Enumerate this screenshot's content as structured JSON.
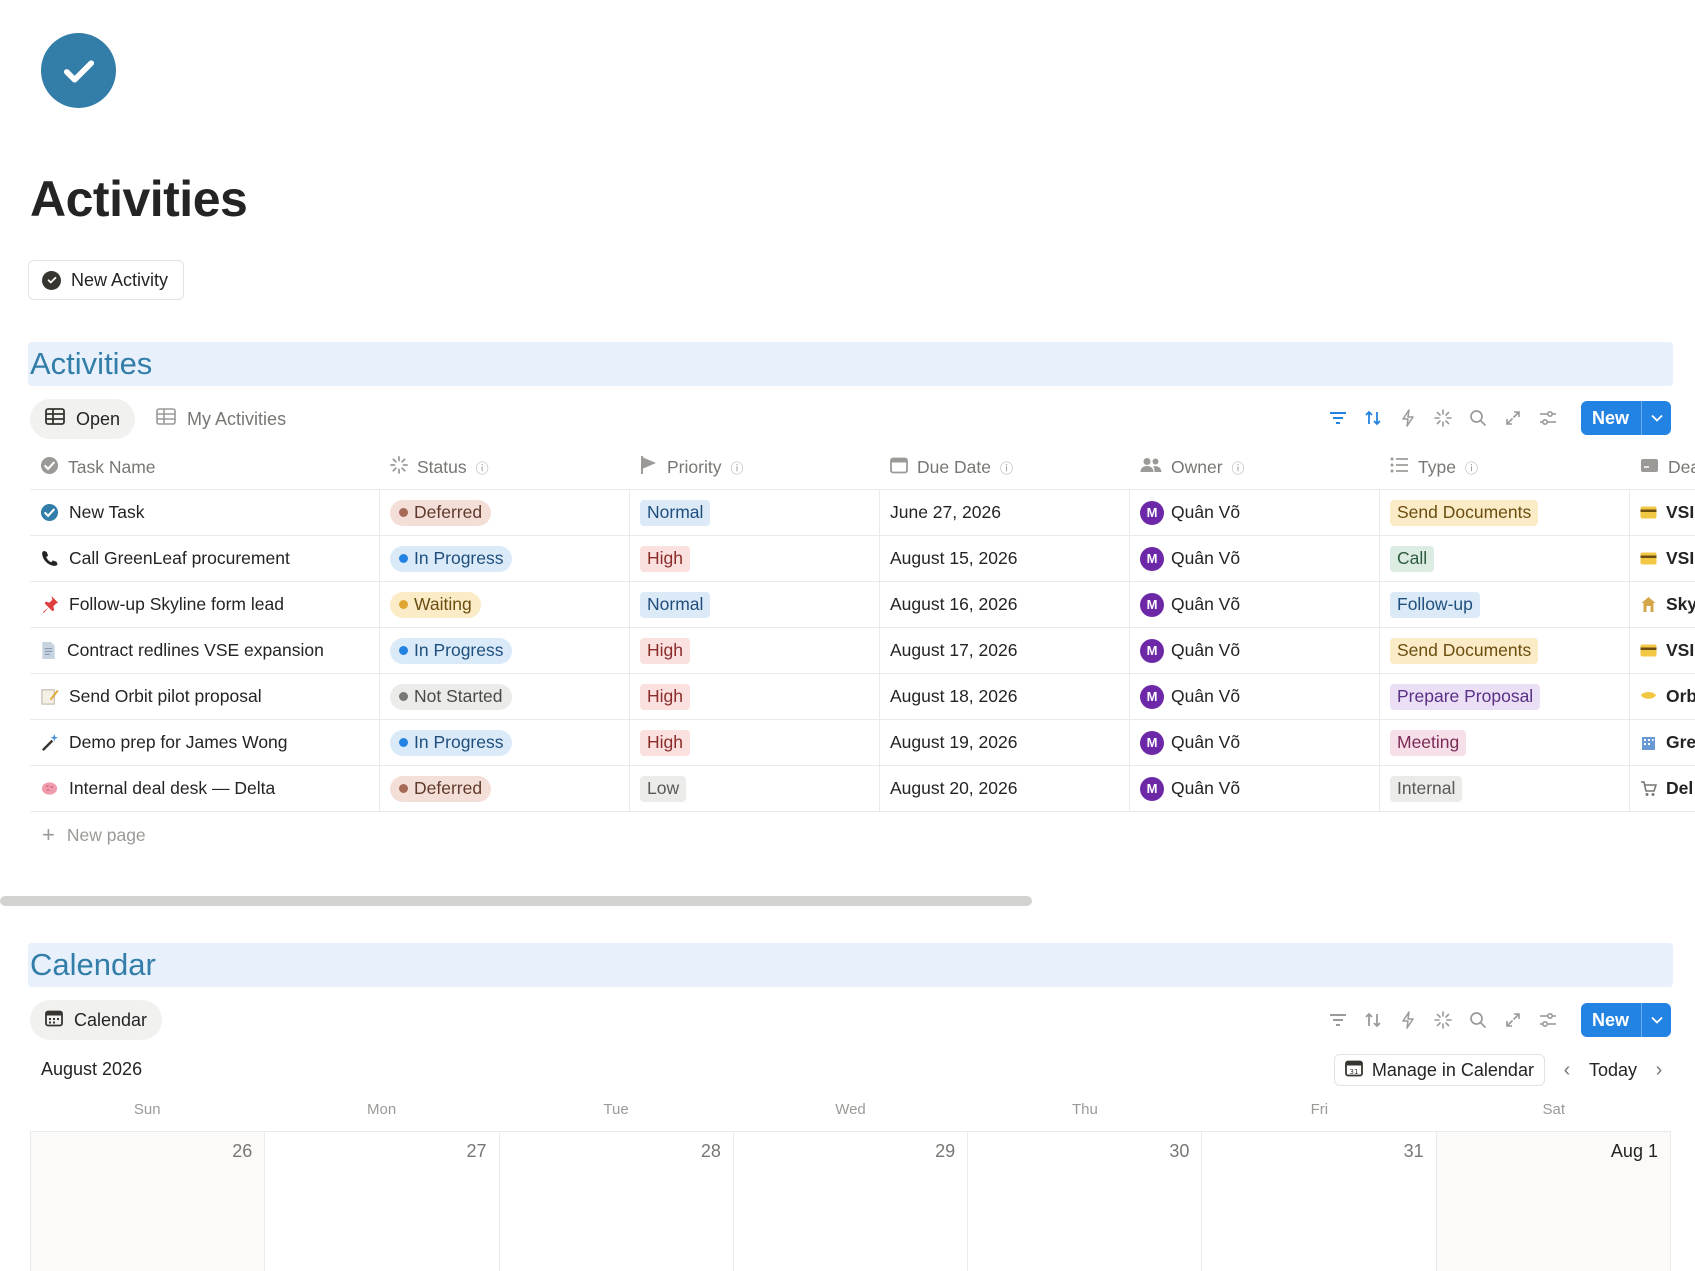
{
  "page": {
    "title": "Activities",
    "new_activity_label": "New Activity"
  },
  "activities_section": {
    "title": "Activities",
    "tabs": [
      {
        "label": "Open",
        "active": true
      },
      {
        "label": "My Activities",
        "active": false
      }
    ],
    "new_label": "New",
    "columns": {
      "task_name": "Task Name",
      "status": "Status",
      "priority": "Priority",
      "due_date": "Due Date",
      "owner": "Owner",
      "type": "Type",
      "deal": "Dea"
    },
    "rows": [
      {
        "icon": "check-circle",
        "name": "New Task",
        "status": "Deferred",
        "priority": "Normal",
        "due": "June 27, 2026",
        "owner_initial": "M",
        "owner": "Quân Võ",
        "type": "Send Documents",
        "deal": "VSI"
      },
      {
        "icon": "phone",
        "name": "Call GreenLeaf procurement",
        "status": "In Progress",
        "priority": "High",
        "due": "August 15, 2026",
        "owner_initial": "M",
        "owner": "Quân Võ",
        "type": "Call",
        "deal": "VSI"
      },
      {
        "icon": "pushpin",
        "name": "Follow-up Skyline form lead",
        "status": "Waiting",
        "priority": "Normal",
        "due": "August 16, 2026",
        "owner_initial": "M",
        "owner": "Quân Võ",
        "type": "Follow-up",
        "deal": "Sky"
      },
      {
        "icon": "document",
        "name": "Contract redlines VSE expansion",
        "status": "In Progress",
        "priority": "High",
        "due": "August 17, 2026",
        "owner_initial": "M",
        "owner": "Quân Võ",
        "type": "Send Documents",
        "deal": "VSI"
      },
      {
        "icon": "memo",
        "name": "Send Orbit pilot proposal",
        "status": "Not Started",
        "priority": "High",
        "due": "August 18, 2026",
        "owner_initial": "M",
        "owner": "Quân Võ",
        "type": "Prepare Proposal",
        "deal": "Orb"
      },
      {
        "icon": "magic-wand",
        "name": "Demo prep for James Wong",
        "status": "In Progress",
        "priority": "High",
        "due": "August 19, 2026",
        "owner_initial": "M",
        "owner": "Quân Võ",
        "type": "Meeting",
        "deal": "Gre"
      },
      {
        "icon": "brain",
        "name": "Internal deal desk — Delta",
        "status": "Deferred",
        "priority": "Low",
        "due": "August 20, 2026",
        "owner_initial": "M",
        "owner": "Quân Võ",
        "type": "Internal",
        "deal": "Del"
      }
    ],
    "new_page_label": "New page"
  },
  "calendar_section": {
    "title": "Calendar",
    "tab_label": "Calendar",
    "new_label": "New",
    "month_label": "August 2026",
    "manage_label": "Manage in Calendar",
    "today_label": "Today",
    "weekdays": [
      "Sun",
      "Mon",
      "Tue",
      "Wed",
      "Thu",
      "Fri",
      "Sat"
    ],
    "days": [
      "26",
      "27",
      "28",
      "29",
      "30",
      "31",
      "Aug 1"
    ]
  },
  "colors": {
    "accent": "#2383e2",
    "section_banner": "#e7f0fb",
    "section_title": "#337ea9",
    "status": {
      "Deferred": {
        "bg": "#f4dfd8",
        "dot": "#a56a55",
        "fg": "#5f3a2c"
      },
      "In Progress": {
        "bg": "#dbeaf8",
        "dot": "#2383e2",
        "fg": "#1f4f7d"
      },
      "Waiting": {
        "bg": "#fbecc7",
        "dot": "#e0a431",
        "fg": "#6b4d10"
      },
      "Not Started": {
        "bg": "#ebebea",
        "dot": "#787774",
        "fg": "#4a4945"
      }
    },
    "priority": {
      "Normal": {
        "bg": "#dceaf8",
        "fg": "#1f4f7d"
      },
      "High": {
        "bg": "#fae0df",
        "fg": "#8a2d2a"
      },
      "Low": {
        "bg": "#ebebea",
        "fg": "#5a5955"
      }
    },
    "type": {
      "Send Documents": {
        "bg": "#fbecc7",
        "fg": "#6b4d10"
      },
      "Call": {
        "bg": "#dcece3",
        "fg": "#2b5b3e"
      },
      "Follow-up": {
        "bg": "#dceaf8",
        "fg": "#1f4f7d"
      },
      "Prepare Proposal": {
        "bg": "#eadff5",
        "fg": "#5b2f85"
      },
      "Meeting": {
        "bg": "#f7dfe9",
        "fg": "#7b2a55"
      },
      "Internal": {
        "bg": "#ebebea",
        "fg": "#5a5955"
      }
    }
  }
}
